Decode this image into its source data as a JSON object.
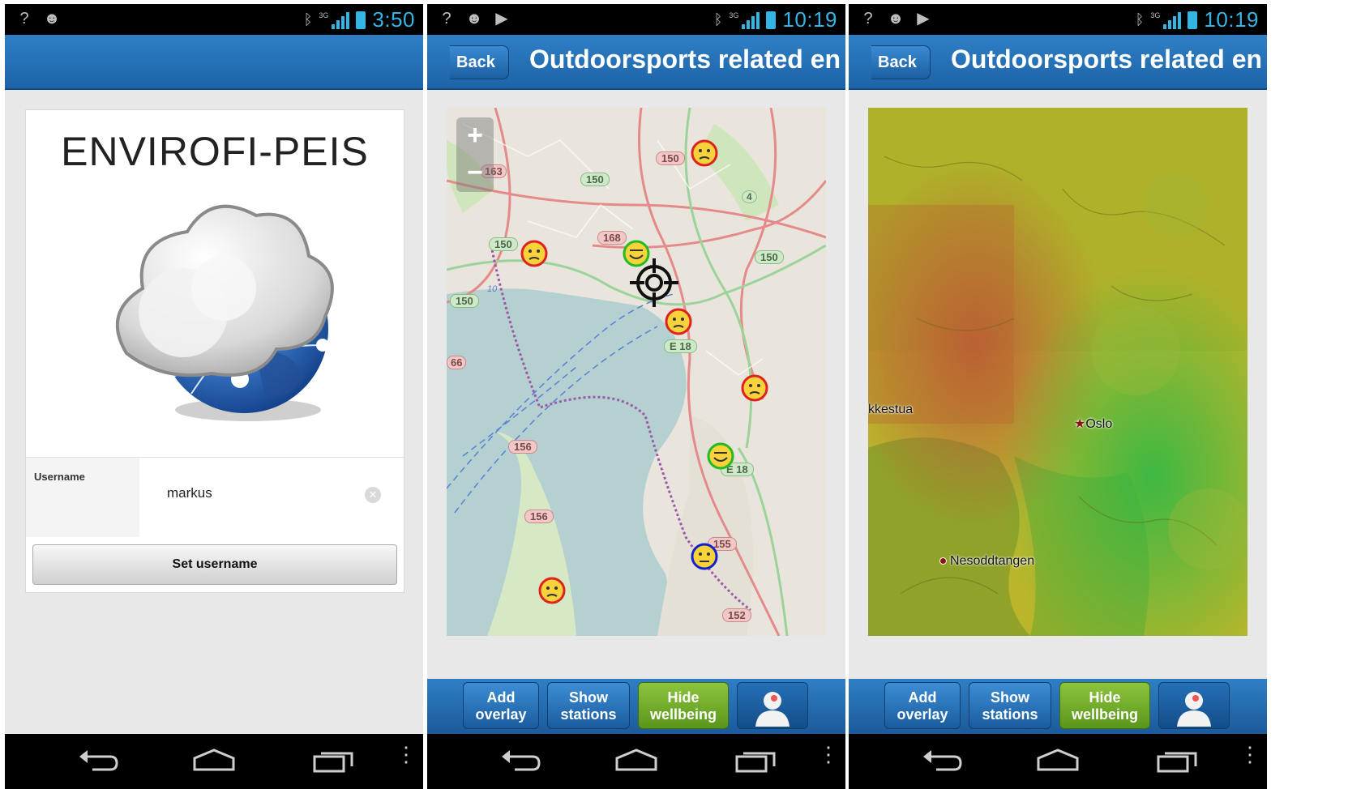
{
  "screens": {
    "login": {
      "time": "3:50",
      "app_title": "ENVIROFI-PEIS",
      "username_label": "Username",
      "username_value": "markus",
      "set_button": "Set username"
    },
    "map": {
      "time": "10:19",
      "back_label": "Back",
      "title": "Outdoorsports related env...",
      "zoom_in": "+",
      "zoom_out": "−",
      "road_labels": [
        "150",
        "150",
        "150",
        "150",
        "150",
        "168",
        "E 18",
        "E 18",
        "156",
        "156",
        "155",
        "152",
        "4",
        "66",
        "10",
        "163"
      ],
      "buttons": {
        "add_overlay": "Add overlay",
        "show_stations": "Show stations",
        "hide_wellbeing": "Hide wellbeing"
      }
    },
    "overlay": {
      "time": "10:19",
      "back_label": "Back",
      "title": "Outdoorsports related env...",
      "places": [
        "kkestua",
        "Oslo",
        "Nesoddtangen"
      ],
      "buttons": {
        "add_overlay": "Add overlay",
        "show_stations": "Show stations",
        "hide_wellbeing": "Hide wellbeing"
      }
    }
  },
  "colors": {
    "accent": "#33b5e5",
    "header": "#1f66ab",
    "green_button": "#7ab534",
    "happy_ring": "#22bb22",
    "sad_ring": "#dd2222",
    "neutral_ring": "#1122cc"
  }
}
